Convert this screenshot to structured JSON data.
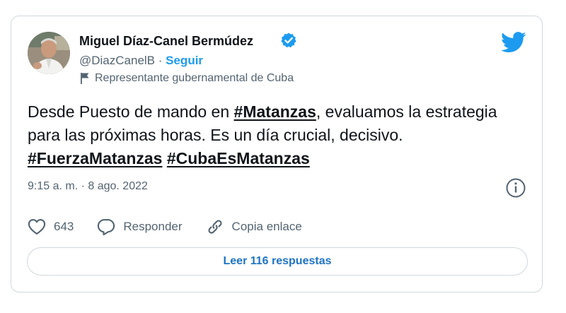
{
  "author": {
    "display_name": "Miguel Díaz-Canel Bermúdez",
    "handle": "@DiazCanelB",
    "separator": " · ",
    "follow_label": "Seguir",
    "label": "Representante gubernamental de Cuba",
    "verified": true
  },
  "tweet": {
    "text_1": "Desde Puesto de mando en ",
    "hashtag_1": "#Matanzas",
    "text_2": ", evaluamos la estrategia para las próximas horas. Es un día crucial, decisivo. ",
    "hashtag_2": "#FuerzaMatanzas",
    "text_3": " ",
    "hashtag_3": "#CubaEsMatanzas",
    "timestamp": "9:15 a. m. · 8 ago. 2022"
  },
  "actions": {
    "like_count": "643",
    "reply_label": "Responder",
    "copy_link_label": "Copia enlace"
  },
  "replies_button": {
    "label": "Leer 116 respuestas"
  },
  "icons": {
    "brand": "twitter-bird-icon",
    "verified": "verified-badge-icon",
    "label": "flag-icon",
    "info": "info-icon",
    "like": "heart-icon",
    "reply": "speech-bubble-icon",
    "copy_link": "link-icon"
  },
  "colors": {
    "brand_blue": "#1d9bf0",
    "text_primary": "#0f1419",
    "text_secondary": "#536471",
    "border": "#cfd9de",
    "replies_link": "#1d74c4"
  }
}
